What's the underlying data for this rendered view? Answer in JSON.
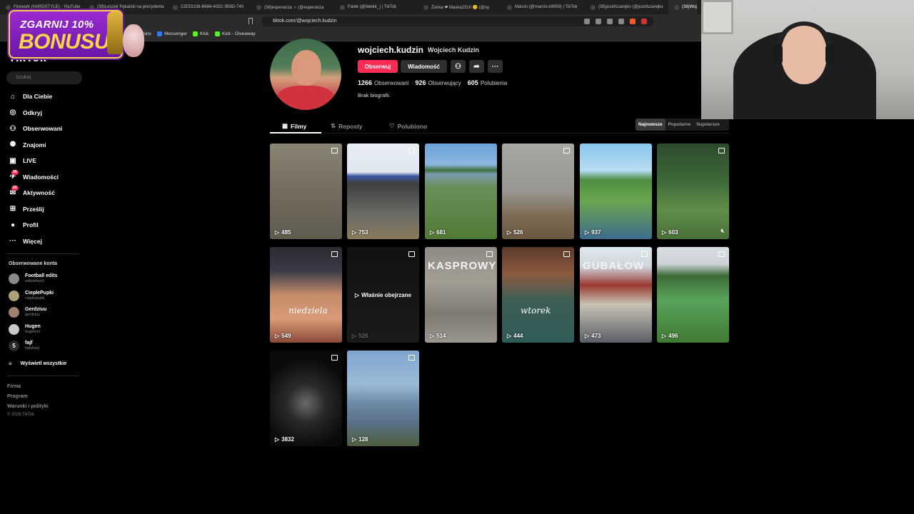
{
  "browser": {
    "tabs": [
      "Firework (HARDSTYLE) - YouTube",
      "(38)Leszek Pękalski na prezydenta",
      "22E53108-B684-402C-959D-740",
      "(38)esperanza ☆ (@esperanza",
      "Fatek (@fatekk_) | TikTok",
      "Żonka ❤ Maska2310 😊 (@sy",
      "Marcin (@marcin.k9009) | TikTok",
      "(38)jozefszarejko (@jozefszarejko",
      "(38)Wojc"
    ],
    "url": "tiktok.com/@wojciech.kudzin",
    "bookmarks": [
      "Messenger",
      "Kick",
      "Kick - Giveaway"
    ],
    "bookmark_partial": "ions"
  },
  "promo": {
    "line1": "ZGARNIJ 10%",
    "line2": "BONUSU"
  },
  "sidebar": {
    "logo": "TikTok",
    "search_placeholder": "Szukaj",
    "nav": [
      {
        "label": "Dla Ciebie",
        "icon": "home-icon"
      },
      {
        "label": "Odkryj",
        "icon": "compass-icon"
      },
      {
        "label": "Obserwowani",
        "icon": "following-icon"
      },
      {
        "label": "Znajomi",
        "icon": "friends-icon"
      },
      {
        "label": "LIVE",
        "icon": "live-icon"
      },
      {
        "label": "Wiadomości",
        "icon": "messages-icon",
        "badge": "36"
      },
      {
        "label": "Aktywność",
        "icon": "activity-icon",
        "badge": "26"
      },
      {
        "label": "Prześlij",
        "icon": "upload-icon"
      },
      {
        "label": "Profil",
        "icon": "profile-icon"
      },
      {
        "label": "Więcej",
        "icon": "more-icon"
      }
    ],
    "following_title": "Obserwowane konta",
    "following": [
      {
        "name": "Football edits",
        "handle": "editstriker0",
        "color": "#8a8a8a"
      },
      {
        "name": "CiepłePupki",
        "handle": "cieplepupki",
        "color": "#b0a07a"
      },
      {
        "name": "Gerdziuu",
        "handle": "gerdziuu",
        "color": "#a08070"
      },
      {
        "name": "Hugen",
        "handle": "hugennn",
        "color": "#c9c9c9"
      },
      {
        "name": "fajf",
        "handle": "fajfshoty",
        "color": "#2a2a2a",
        "initial": "5"
      }
    ],
    "see_all": "Wyświetl wszystkie",
    "footer": [
      "Firma",
      "Program",
      "Warunki i polityki"
    ],
    "copyright": "© 2026 TikTok"
  },
  "profile": {
    "username": "wojciech.kudzin",
    "display_name": "Wojciech Kudzin",
    "follow_button": "Obserwuj",
    "message_button": "Wiadomość",
    "following_count": "1266",
    "following_label": "Obserwowani",
    "followers_count": "926",
    "followers_label": "Obserwujący",
    "likes_count": "605",
    "likes_label": "Polubienia",
    "bio": "Brak biografii.",
    "tabs": [
      "Filmy",
      "Reposty",
      "Polubiono"
    ],
    "sort": [
      "Najnowsze",
      "Popularne",
      "Najstarsze"
    ]
  },
  "videos": [
    {
      "views": "485",
      "bg": "linear-gradient(180deg,#8a8575 0%,#756f60 45%,#5e5a4e 100%)"
    },
    {
      "views": "753",
      "bg": "linear-gradient(180deg,#e8eef4 0%,#dfe6ee 30%,#3a58a6 34%,#3f3f3f 42%,#6b6b66 75%,#8a7a5a 100%)"
    },
    {
      "views": "681",
      "bg": "linear-gradient(180deg,#6aa2d8 0%,#8cb6de 22%,#3d6f3a 28%,#7a9bb0 32%,#6b8f5a 45%,#4f7a33 100%)"
    },
    {
      "views": "526",
      "bg": "linear-gradient(180deg,#a8a7a2 0%,#979690 50%,#7d6c55 75%,#6a5741 100%)"
    },
    {
      "views": "937",
      "bg": "linear-gradient(180deg,#88c6ee 0%,#b9dcf2 28%,#4c8f44 38%,#6aa84f 60%,#3d6b8e 100%)"
    },
    {
      "views": "603",
      "bg": "linear-gradient(180deg,#2c4a2c 0%,#3f6a39 40%,#5f8f49 70%,#4a6e38 100%)",
      "muted": true
    },
    {
      "views": "549",
      "bg": "linear-gradient(180deg,#2b2b33 0%,#3a3a48 25%,#c48c6a 50%,#d89a76 75%,#8b4a3a 100%)",
      "caption": "niedziela"
    },
    {
      "views": "526",
      "bg": "linear-gradient(180deg,#121212 0%,#1a1a1a 100%)",
      "watched": "Właśnie obejrzane"
    },
    {
      "views": "514",
      "bg": "linear-gradient(180deg,#8e8b84 0%,#a49f95 35%,#7d7a73 70%,#9b968e 100%)",
      "banner": "KASPROWY"
    },
    {
      "views": "444",
      "bg": "linear-gradient(180deg,#5c3a2c 0%,#8c5a3e 28%,#3e5e56 55%,#2e5c58 100%)",
      "caption": "wtorek"
    },
    {
      "views": "473",
      "bg": "linear-gradient(180deg,#dfe7ee 0%,#cfd7de 20%,#9a3a30 40%,#c8c2b5 60%,#5a5f66 100%)",
      "banner": "GUBAŁOW"
    },
    {
      "views": "496",
      "bg": "linear-gradient(180deg,#d9dde2 0%,#cdd3d9 18%,#3c6b36 30%,#5aa35a 55%,#3f7a33 100%)"
    },
    {
      "views": "3832",
      "bg": "radial-gradient(circle at 50% 55%,#6a6a6a 0%,#2a2a2a 30%,#0a0a0a 70%)"
    },
    {
      "views": "128",
      "bg": "linear-gradient(180deg,#7fa6cf 0%,#9bbbd8 35%,#6d8aa6 55%,#5a7088 75%,#4d5f3d 100%)"
    }
  ]
}
